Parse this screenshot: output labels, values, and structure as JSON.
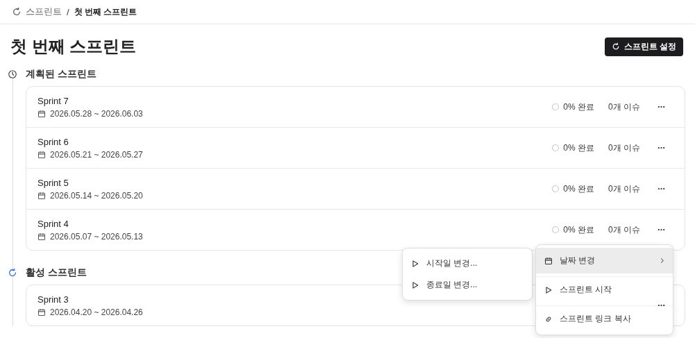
{
  "breadcrumb": {
    "items": [
      {
        "label": "스프린트"
      },
      {
        "label": "첫 번째 스프린트"
      }
    ],
    "separator": "/"
  },
  "title": "첫 번째 스프린트",
  "settings_button": "스프린트 설정",
  "sections": [
    {
      "kind": "planned",
      "title": "계획된 스프린트",
      "sprints": [
        {
          "name": "Sprint 7",
          "dates": "2026.05.28 ~ 2026.06.03",
          "progress": "0% 완료",
          "issues": "0개 이슈"
        },
        {
          "name": "Sprint 6",
          "dates": "2026.05.21 ~ 2026.05.27",
          "progress": "0% 완료",
          "issues": "0개 이슈"
        },
        {
          "name": "Sprint 5",
          "dates": "2026.05.14 ~ 2026.05.20",
          "progress": "0% 완료",
          "issues": "0개 이슈"
        },
        {
          "name": "Sprint 4",
          "dates": "2026.05.07 ~ 2026.05.13",
          "progress": "0% 완료",
          "issues": "0개 이슈"
        }
      ]
    },
    {
      "kind": "active",
      "title": "활성 스프린트",
      "sprints": [
        {
          "name": "Sprint 3",
          "dates": "2026.04.20 ~ 2026.04.26"
        }
      ]
    }
  ],
  "context_menu": {
    "items": [
      {
        "kind": "submenu",
        "label": "날짜 변경",
        "selected": true
      },
      {
        "kind": "start",
        "label": "스프린트 시작",
        "selected": false
      },
      {
        "kind": "copy_link",
        "label": "스프린트 링크 복사",
        "selected": false
      }
    ]
  },
  "submenu": {
    "items": [
      {
        "label": "시작일 변경..."
      },
      {
        "label": "종료일 변경..."
      }
    ]
  }
}
